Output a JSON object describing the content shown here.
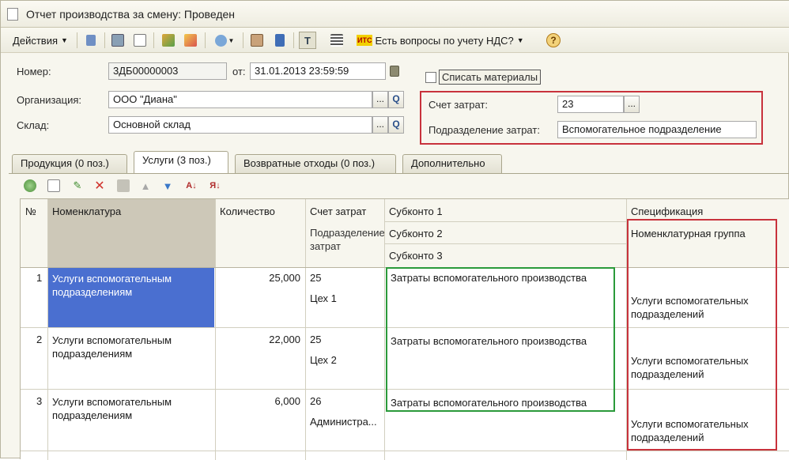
{
  "window": {
    "title": "Отчет производства за смену: Проведен"
  },
  "toolbar": {
    "actions_label": "Действия",
    "vat_label": "Есть вопросы по учету НДС?",
    "vat_badge": "ИТС",
    "help_glyph": "?"
  },
  "form": {
    "number_label": "Номер:",
    "number_value": "3ДБ00000003",
    "date_label": "от:",
    "date_value": "31.01.2013 23:59:59",
    "org_label": "Организация:",
    "org_value": "ООО \"Диана\"",
    "warehouse_label": "Склад:",
    "warehouse_value": "Основной склад",
    "writeoff_label": "Списать материалы",
    "account_label": "Счет затрат:",
    "account_value": "23",
    "dept_label": "Подразделение затрат:",
    "dept_value": "Вспомогательное подразделение",
    "ellipsis": "...",
    "search_glyph": "Q"
  },
  "tabs": [
    {
      "label": "Продукция (0 поз.)"
    },
    {
      "label": "Услуги (3 поз.)"
    },
    {
      "label": "Возвратные отходы (0 поз.)"
    },
    {
      "label": "Дополнительно"
    }
  ],
  "table": {
    "headers": {
      "num": "№",
      "nomenclature": "Номенклатура",
      "quantity": "Количество",
      "account": "Счет затрат",
      "dept": "Подразделение затрат",
      "sub1": "Субконто 1",
      "sub2": "Субконто 2",
      "sub3": "Субконто 3",
      "spec": "Спецификация",
      "nomgroup": "Номенклатурная группа"
    },
    "rows": [
      {
        "num": "1",
        "nomenclature": "Услуги вспомогательным подразделениям",
        "quantity": "25,000",
        "account": "25",
        "dept": "Цех 1",
        "sub1": "Затраты вспомогательного производства",
        "nomgroup": "Услуги вспомогательных подразделений"
      },
      {
        "num": "2",
        "nomenclature": "Услуги вспомогательным подразделениям",
        "quantity": "22,000",
        "account": "25",
        "dept": "Цех 2",
        "sub1": "Затраты вспомогательного производства",
        "nomgroup": "Услуги вспомогательных подразделений"
      },
      {
        "num": "3",
        "nomenclature": "Услуги вспомогательным подразделениям",
        "quantity": "6,000",
        "account": "26",
        "dept": "Администра...",
        "sub1": "Затраты вспомогательного производства",
        "nomgroup": "Услуги вспомогательных подразделений"
      }
    ]
  },
  "colors": {
    "selected_cell": "#4a6fd0",
    "highlight_red": "#c8323c",
    "highlight_green": "#2a9a3a"
  }
}
